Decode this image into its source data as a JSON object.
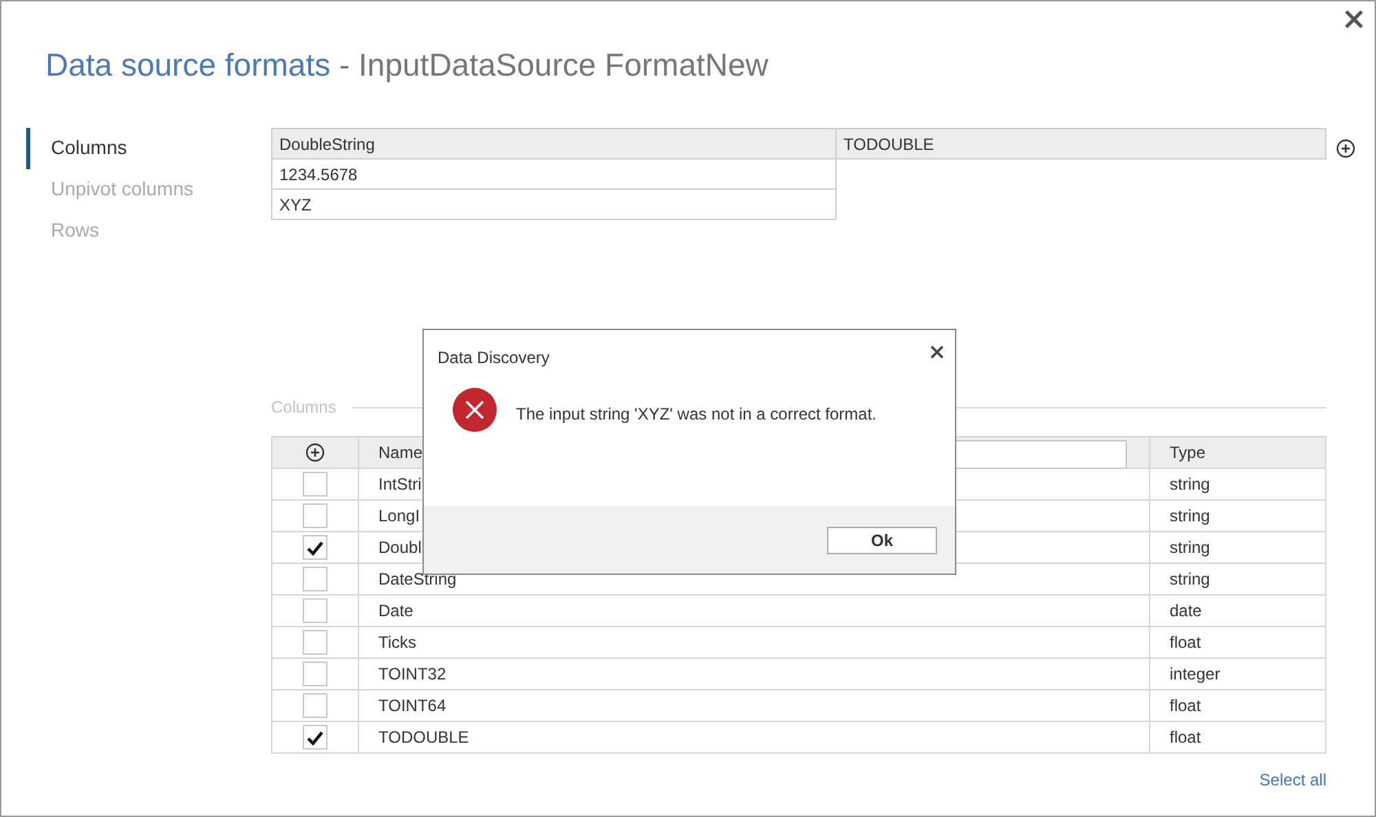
{
  "window": {
    "title": "Data source formats",
    "subtitle": "- InputDataSource FormatNew"
  },
  "sidebar": {
    "items": [
      {
        "label": "Columns",
        "selected": true
      },
      {
        "label": "Unpivot columns",
        "selected": false
      },
      {
        "label": "Rows",
        "selected": false
      }
    ]
  },
  "preview": {
    "columns": [
      "DoubleString",
      "TODOUBLE"
    ],
    "rows": [
      [
        "1234.5678"
      ],
      [
        "XYZ"
      ]
    ]
  },
  "columns_section": {
    "legend": "Columns",
    "name_header": "Name",
    "type_header": "Type",
    "rows": [
      {
        "name": "IntStri",
        "type": "string",
        "checked": false
      },
      {
        "name": "LongI",
        "type": "string",
        "checked": false
      },
      {
        "name": "Doubl",
        "type": "string",
        "checked": true
      },
      {
        "name": "DateString",
        "type": "string",
        "checked": false
      },
      {
        "name": "Date",
        "type": "date",
        "checked": false
      },
      {
        "name": "Ticks",
        "type": "float",
        "checked": false
      },
      {
        "name": "TOINT32",
        "type": "integer",
        "checked": false
      },
      {
        "name": "TOINT64",
        "type": "float",
        "checked": false
      },
      {
        "name": "TODOUBLE",
        "type": "float",
        "checked": true
      }
    ],
    "select_all": "Select all"
  },
  "dialog": {
    "title": "Data Discovery",
    "message": "The input string 'XYZ' was not in a correct format.",
    "button": "Ok"
  }
}
